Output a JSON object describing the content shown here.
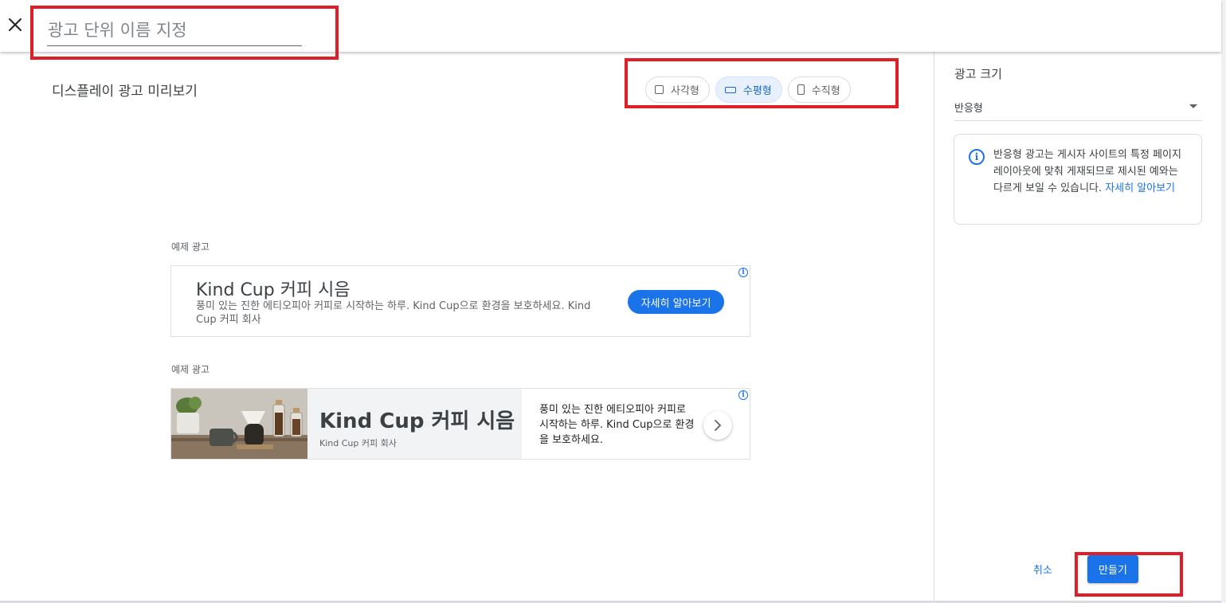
{
  "header": {
    "ad_unit_name_placeholder": "광고 단위 이름 지정"
  },
  "preview": {
    "title": "디스플레이 광고 미리보기",
    "shape_options": [
      {
        "label": "사각형",
        "selected": false,
        "icon": "square-icon"
      },
      {
        "label": "수평형",
        "selected": true,
        "icon": "horizontal-rectangle-icon"
      },
      {
        "label": "수직형",
        "selected": false,
        "icon": "vertical-rectangle-icon"
      }
    ],
    "ads": [
      {
        "label": "예제 광고",
        "headline": "Kind Cup 커피 시음",
        "description": "풍미 있는 진한 에티오피아 커피로 시작하는 하루. Kind Cup으로 환경을 보호하세요. Kind Cup 커피 회사",
        "cta": "자세히 알아보기"
      },
      {
        "label": "예제 광고",
        "headline": "Kind Cup 커피 시음",
        "advertiser": "Kind Cup 커피 회사",
        "description": "풍미 있는 진한 에티오피아 커피로 시작하는 하루. Kind Cup으로 환경을 보호하세요."
      }
    ]
  },
  "sidebar": {
    "size_title": "광고 크기",
    "size_value": "반응형",
    "info_text": "반응형 광고는 게시자 사이트의 특정 페이지 레이아웃에 맞춰 게재되므로 제시된 예와는 다르게 보일 수 있습니다.",
    "info_link": "자세히 알아보기"
  },
  "footer": {
    "cancel_label": "취소",
    "create_label": "만들기"
  },
  "colors": {
    "accent": "#1a73e8",
    "selected_chip_bg": "#e8f0fe",
    "annotation_red": "#e01e28"
  }
}
